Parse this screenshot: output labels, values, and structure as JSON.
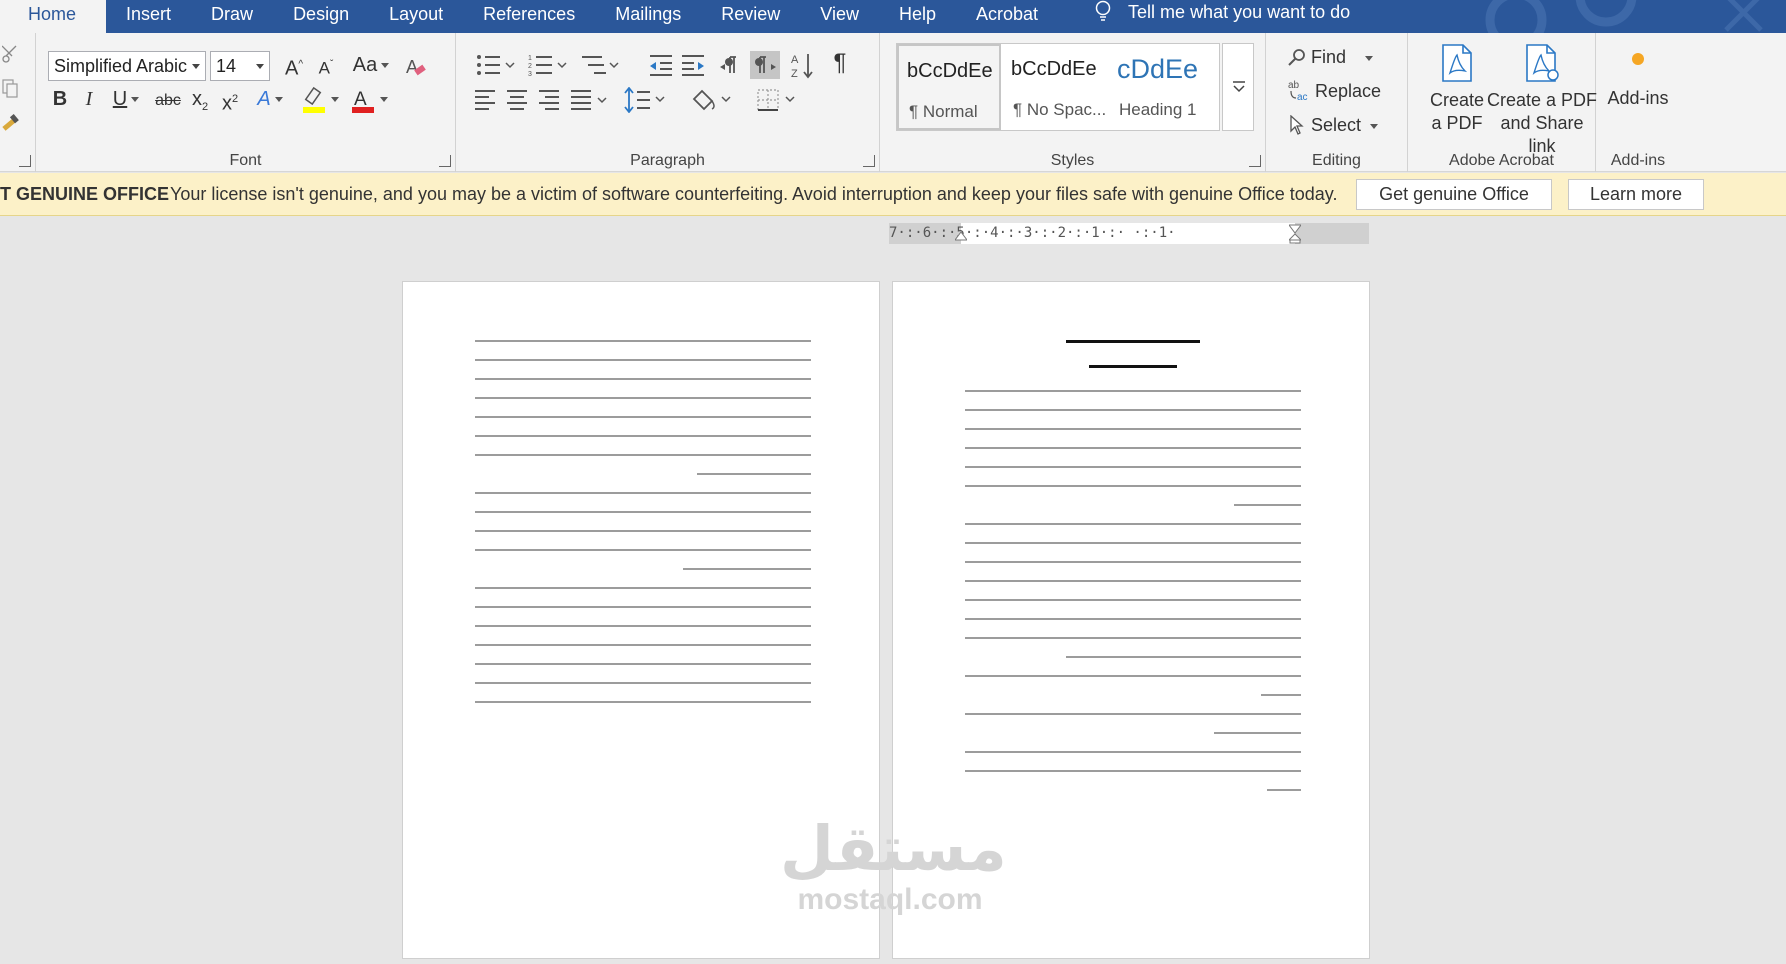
{
  "tabs": [
    "Home",
    "Insert",
    "Draw",
    "Design",
    "Layout",
    "References",
    "Mailings",
    "Review",
    "View",
    "Help",
    "Acrobat"
  ],
  "tell_me": "Tell me what you want to do",
  "font": {
    "name": "Simplified Arabic",
    "size": "14",
    "group_label": "Font",
    "change_case": "Aa"
  },
  "paragraph": {
    "group_label": "Paragraph"
  },
  "styles": {
    "group_label": "Styles",
    "items": [
      {
        "sample": "bCcDdEe",
        "name": "¶ Normal"
      },
      {
        "sample": "bCcDdEe",
        "name": "¶ No Spac..."
      },
      {
        "sample": "cDdEe",
        "name": "Heading 1"
      }
    ]
  },
  "editing": {
    "group_label": "Editing",
    "find": "Find",
    "replace": "Replace",
    "select": "Select"
  },
  "acrobat": {
    "group_label": "Adobe Acrobat",
    "create_pdf_line1": "Create",
    "create_pdf_line2": "a PDF",
    "share_line1": "Create a PDF",
    "share_line2": "and Share link"
  },
  "addins": {
    "label": "Add-ins",
    "group_label": "Add-ins"
  },
  "license": {
    "title": "T GENUINE OFFICE",
    "message": "Your license isn't genuine, and you may be a victim of software counterfeiting. Avoid interruption and keep your files safe with genuine Office today.",
    "get_button": "Get genuine Office",
    "learn_button": "Learn more"
  },
  "ruler": "7·:·6·:·5·:·4·:·3·:·2·:·1·:·  ·:·1·",
  "watermark": {
    "arabic": "مستقل",
    "latin": "mostaql.com"
  },
  "colors": {
    "tab_bar": "#2b579a",
    "license_bar": "#fcf1c8",
    "font_color": "#e02020",
    "highlight": "#ffff00"
  }
}
